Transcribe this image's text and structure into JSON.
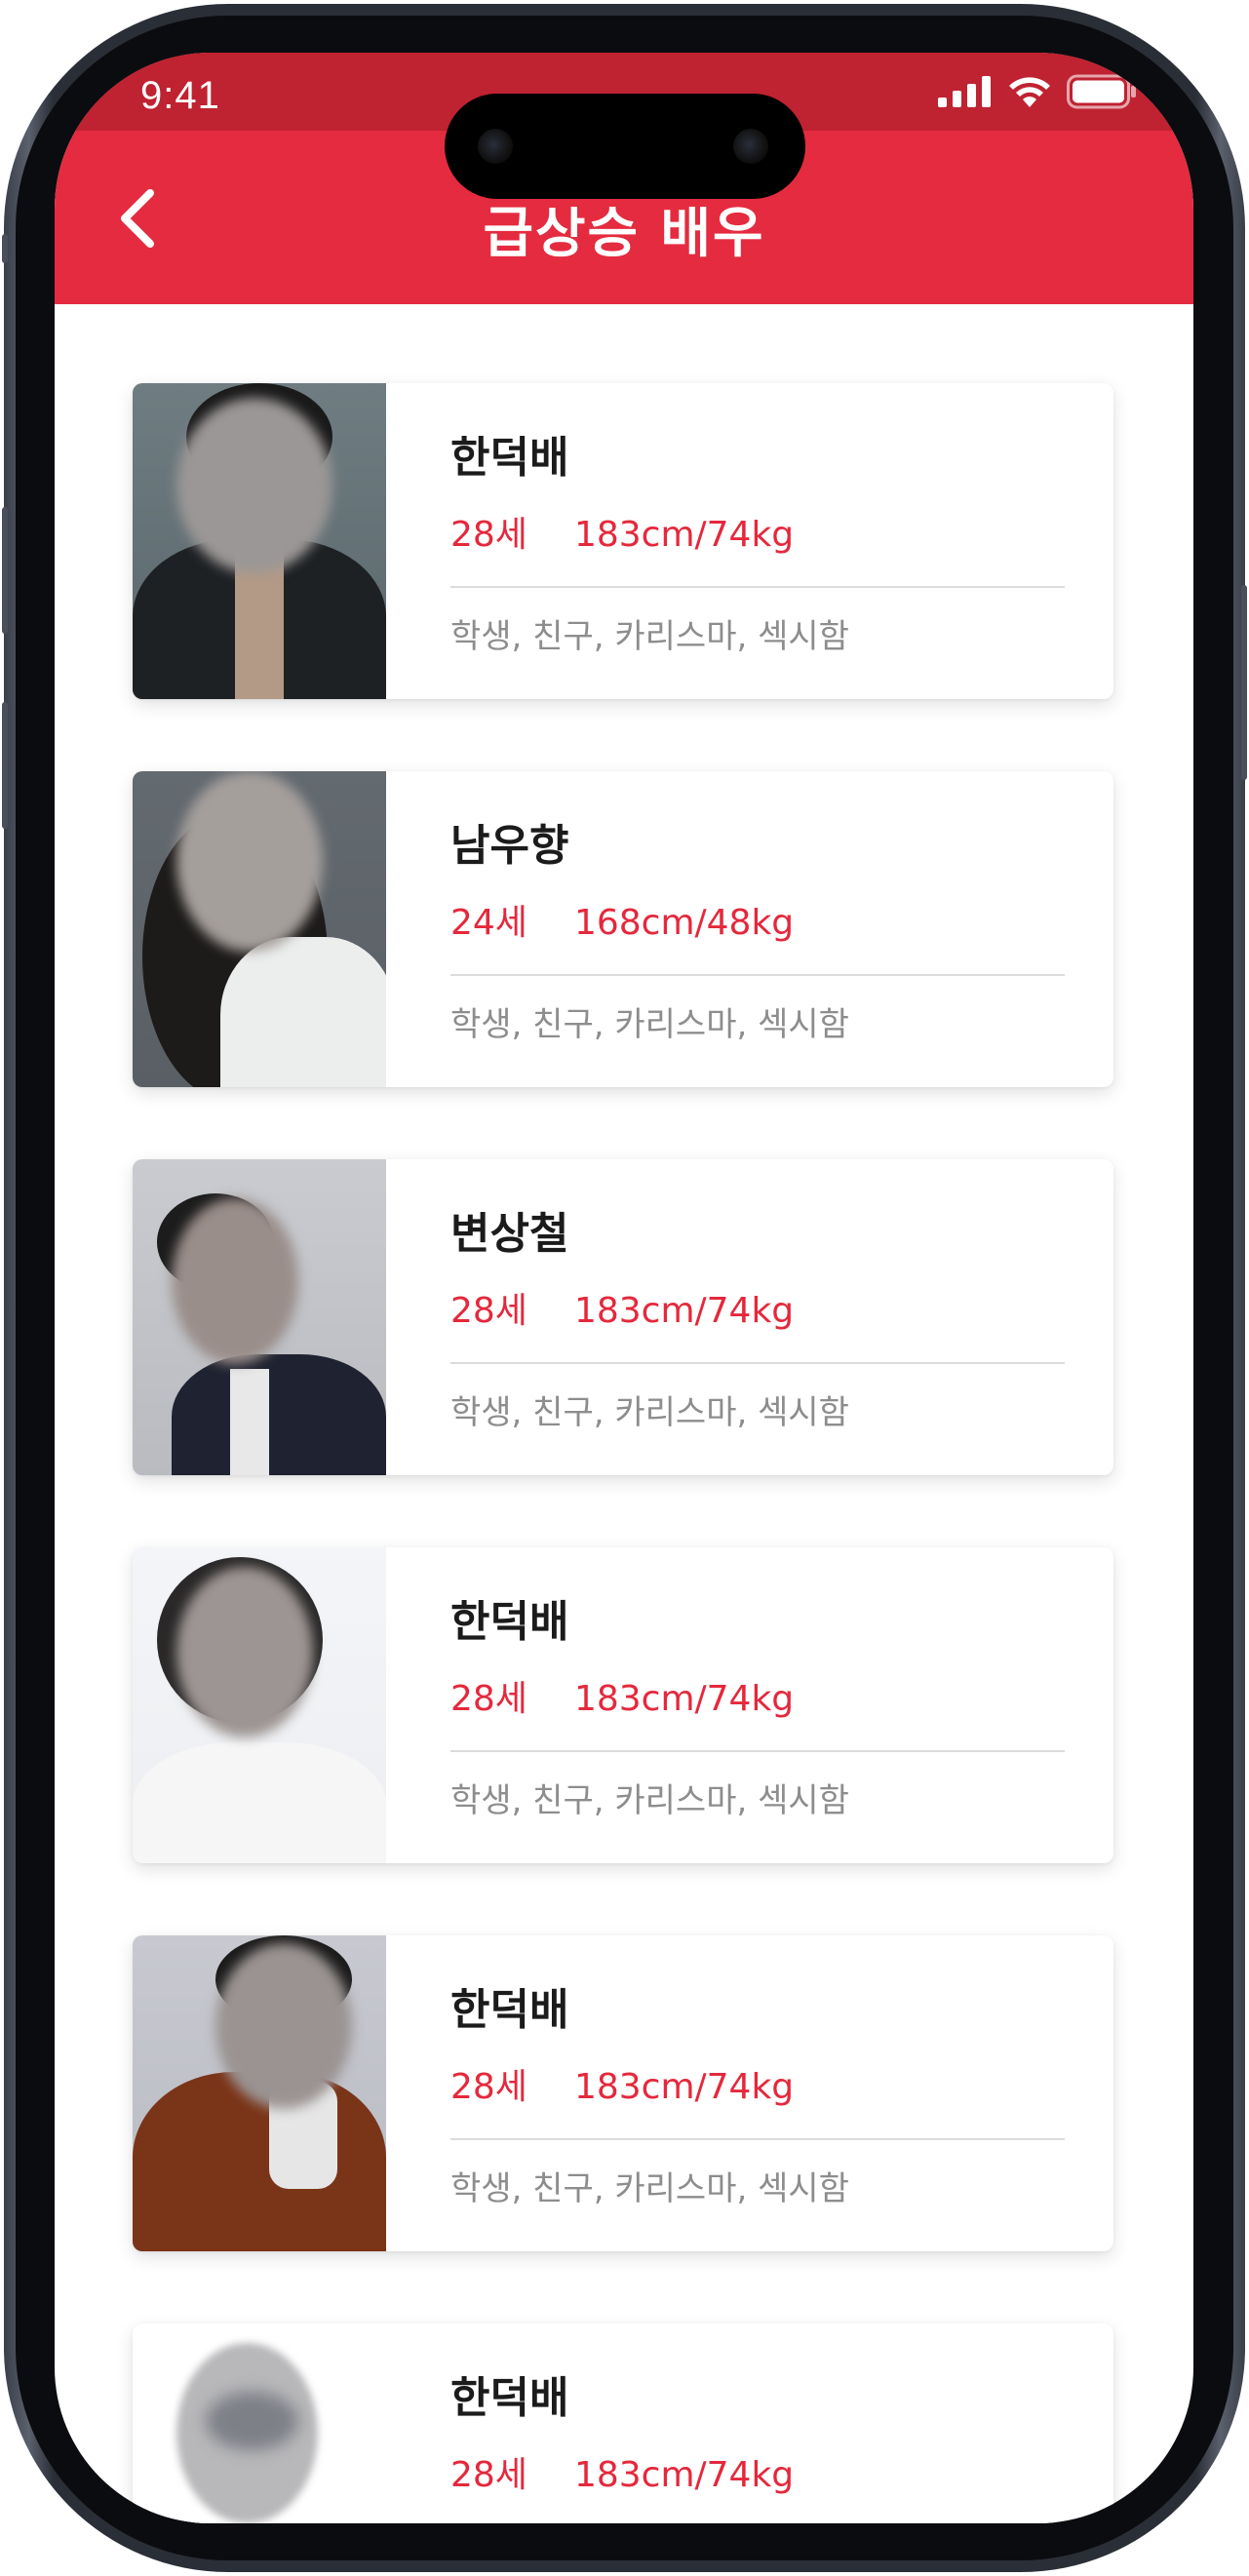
{
  "status_bar": {
    "time": "9:41"
  },
  "header": {
    "title": "급상승 배우",
    "back_icon": "chevron-left-icon",
    "background_color": "#e52b3f"
  },
  "actors": [
    {
      "name": "한덕배",
      "age": "28세",
      "size": "183cm/74kg",
      "tags": "학생, 친구, 카리스마, 섹시함"
    },
    {
      "name": "남우향",
      "age": "24세",
      "size": "168cm/48kg",
      "tags": "학생, 친구, 카리스마, 섹시함"
    },
    {
      "name": "변상철",
      "age": "28세",
      "size": "183cm/74kg",
      "tags": "학생, 친구, 카리스마, 섹시함"
    },
    {
      "name": "한덕배",
      "age": "28세",
      "size": "183cm/74kg",
      "tags": "학생, 친구, 카리스마, 섹시함"
    },
    {
      "name": "한덕배",
      "age": "28세",
      "size": "183cm/74kg",
      "tags": "학생, 친구, 카리스마, 섹시함"
    },
    {
      "name": "한덕배",
      "age": "28세",
      "size": "183cm/74kg",
      "tags": ""
    }
  ],
  "colors": {
    "accent": "#e5283c",
    "tag_text": "#8d8d8d",
    "name_text": "#1b1b1b"
  }
}
